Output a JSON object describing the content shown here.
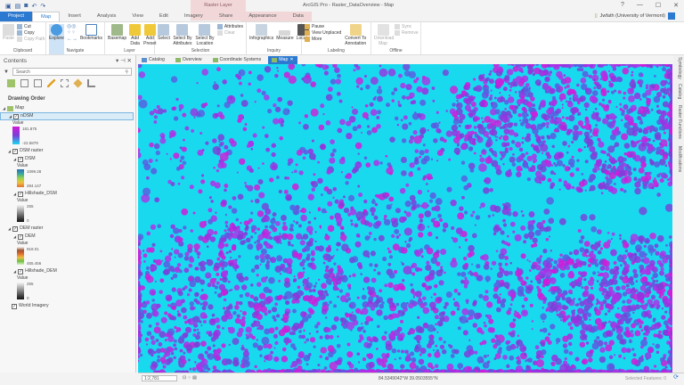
{
  "app": {
    "title": "ArcGIS Pro - Raster_DataOverview - Map",
    "context_group": "Raster Layer",
    "window_controls": [
      "?",
      "—",
      "☐",
      "✕"
    ],
    "user": "Jwfath (University of Vermont)"
  },
  "tabs": [
    "Project",
    "Map",
    "Insert",
    "Analysis",
    "View",
    "Edit",
    "Imagery",
    "Share",
    "Appearance",
    "Data"
  ],
  "ribbon": {
    "clipboard": {
      "label": "Clipboard",
      "paste": "Paste",
      "cut": "Cut",
      "copy": "Copy",
      "copy_path": "Copy Path"
    },
    "navigate": {
      "label": "Navigate",
      "explore": "Explore",
      "bookmarks": "Bookmarks"
    },
    "layer": {
      "label": "Layer",
      "basemap": "Basemap",
      "add_data": "Add Data",
      "add_preset": "Add Preset"
    },
    "selection": {
      "label": "Selection",
      "select": "Select",
      "by_attr": "Select By Attributes",
      "by_loc": "Select By Location",
      "attributes": "Attributes",
      "clear": "Clear"
    },
    "inquiry": {
      "label": "Inquiry",
      "infographics": "Infographics",
      "measure": "Measure",
      "locate": "Locate"
    },
    "labeling": {
      "label": "Labeling",
      "pause": "Pause",
      "view_unplaced": "View Unplaced",
      "more": "More",
      "convert": "Convert To Annotation"
    },
    "offline": {
      "label": "Offline",
      "download": "Download Map",
      "sync": "Sync",
      "remove": "Remove"
    }
  },
  "contents": {
    "title": "Contents",
    "search_placeholder": "Search",
    "drawing_order": "Drawing Order",
    "map": "Map",
    "layers": [
      {
        "name": "nDSM",
        "value_label": "Value",
        "max": "181.875",
        "min": "-22.5879"
      },
      {
        "name": "DSM raster"
      },
      {
        "name": "DSM",
        "value_label": "Value",
        "max": "1099.28",
        "min": "284.147"
      },
      {
        "name": "Hillshade_DSM",
        "value_label": "Value",
        "max": "255",
        "min": "0"
      },
      {
        "name": "DEM raster"
      },
      {
        "name": "DEM",
        "value_label": "Value",
        "max": "918.01",
        "min": "455.456"
      },
      {
        "name": "Hillshade_DEM",
        "value_label": "Value",
        "max": "255",
        "min": "0"
      },
      {
        "name": "World Imagery"
      }
    ]
  },
  "view_tabs": [
    "Catalog",
    "Overview",
    "Coordinate Systems",
    "Map"
  ],
  "side_tabs": [
    "Symbology",
    "Catalog",
    "Raster Functions",
    "Modifications"
  ],
  "status": {
    "scale": "1:2,781",
    "coordinates": "84.5349042°W 39.0503555°N",
    "selected_features": "Selected Features: 0"
  },
  "colors": {
    "accent": "#2b79d1",
    "map_low": "#19d9ef",
    "map_high": "#d21bd9",
    "map_mid": "#7a3fd8"
  }
}
